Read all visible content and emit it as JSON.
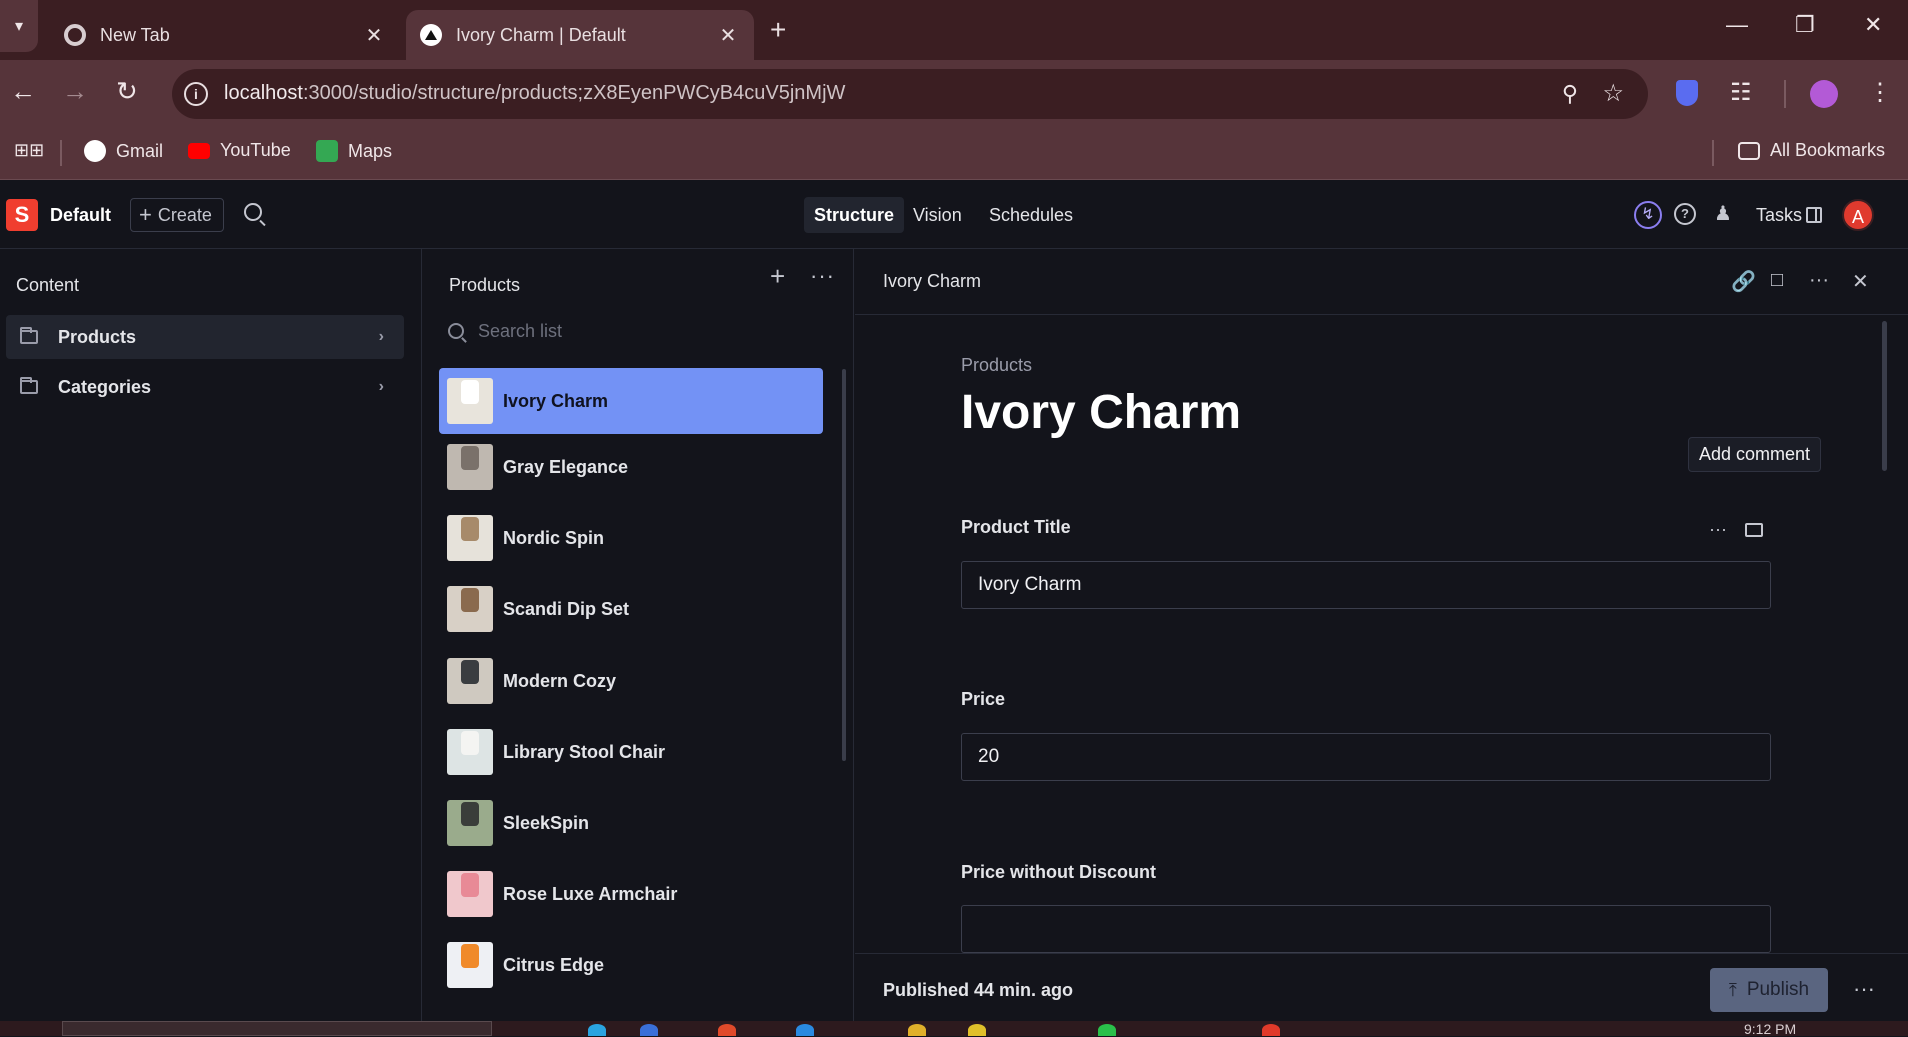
{
  "browser": {
    "tabs": [
      {
        "title": "New Tab",
        "active": false
      },
      {
        "title": "Ivory Charm | Default",
        "active": true
      }
    ],
    "url_host": "localhost",
    "url_path": ":3000/studio/structure/products;zX8EyenPWCyB4cuV5jnMjW",
    "bookmarks": [
      "Gmail",
      "YouTube",
      "Maps"
    ],
    "all_bookmarks": "All Bookmarks"
  },
  "studio": {
    "logo_letter": "S",
    "workspace": "Default",
    "create_label": "Create",
    "nav_tabs": [
      "Structure",
      "Vision",
      "Schedules"
    ],
    "active_tab": "Structure",
    "tasks_label": "Tasks",
    "avatar_letter": "A"
  },
  "content_pane": {
    "title": "Content",
    "items": [
      {
        "label": "Products",
        "selected": true
      },
      {
        "label": "Categories",
        "selected": false
      }
    ]
  },
  "products_pane": {
    "title": "Products",
    "search_placeholder": "Search list",
    "items": [
      {
        "label": "Ivory Charm",
        "selected": true,
        "thumb_bg": "#e8e4dc",
        "thumb_fg": "#ffffff"
      },
      {
        "label": "Gray Elegance",
        "selected": false,
        "thumb_bg": "#bfb8b0",
        "thumb_fg": "#7a716a"
      },
      {
        "label": "Nordic Spin",
        "selected": false,
        "thumb_bg": "#e6e2da",
        "thumb_fg": "#a78a6a"
      },
      {
        "label": "Scandi Dip Set",
        "selected": false,
        "thumb_bg": "#d8d0c6",
        "thumb_fg": "#8a6a4e"
      },
      {
        "label": "Modern Cozy",
        "selected": false,
        "thumb_bg": "#cfc9c0",
        "thumb_fg": "#3a3d40"
      },
      {
        "label": "Library Stool Chair",
        "selected": false,
        "thumb_bg": "#dde4e4",
        "thumb_fg": "#f4f4f2"
      },
      {
        "label": "SleekSpin",
        "selected": false,
        "thumb_bg": "#9aab8c",
        "thumb_fg": "#3a3d3a"
      },
      {
        "label": "Rose Luxe Armchair",
        "selected": false,
        "thumb_bg": "#f0c8cc",
        "thumb_fg": "#e88a96"
      },
      {
        "label": "Citrus Edge",
        "selected": false,
        "thumb_bg": "#eef0f4",
        "thumb_fg": "#f08a2a"
      }
    ]
  },
  "document": {
    "header_title": "Ivory Charm",
    "breadcrumb": "Products",
    "title": "Ivory Charm",
    "tooltip": "Add comment",
    "fields": [
      {
        "label": "Product Title",
        "value": "Ivory Charm"
      },
      {
        "label": "Price",
        "value": "20"
      },
      {
        "label": "Price without Discount",
        "value": ""
      }
    ],
    "status": "Published 44 min. ago",
    "publish_label": "Publish"
  },
  "taskbar": {
    "clock": "9:12 PM"
  }
}
